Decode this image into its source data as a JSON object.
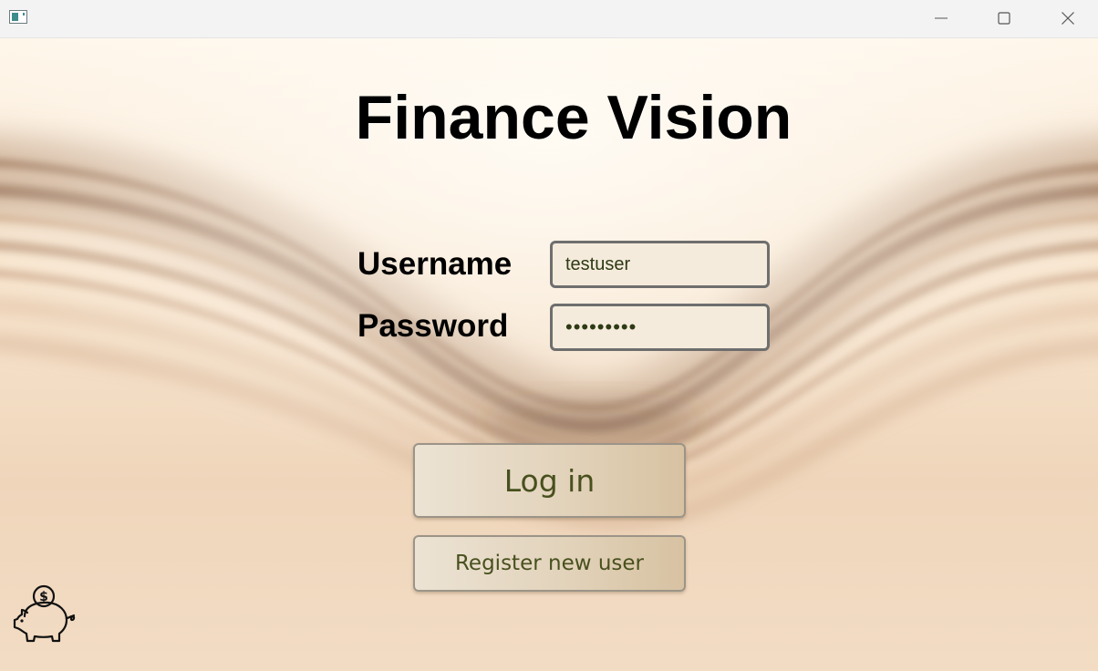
{
  "window": {
    "app_icon": "app-window-icon",
    "controls": {
      "minimize": "minimize-icon",
      "maximize": "maximize-icon",
      "close": "close-icon"
    }
  },
  "app": {
    "title": "Finance Vision"
  },
  "login": {
    "username_label": "Username",
    "username_value": "testuser",
    "password_label": "Password",
    "password_value": "testuser1",
    "login_button": "Log in",
    "register_button": "Register new user"
  },
  "decor": {
    "logo_icon": "piggy-bank-icon"
  },
  "colors": {
    "title_text": "#000000",
    "button_text": "#48501e",
    "field_border": "#6e6e6e",
    "field_bg": "#f5ebdc"
  }
}
